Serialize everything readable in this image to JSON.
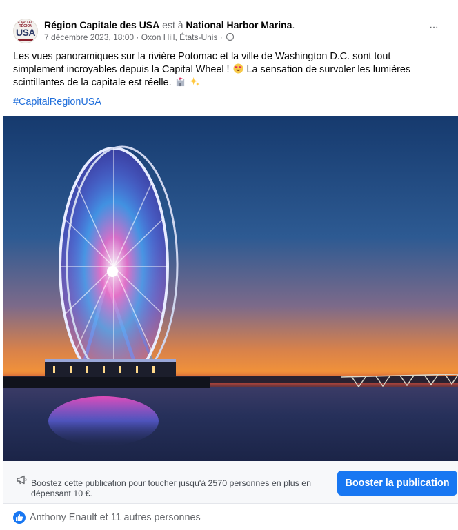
{
  "post": {
    "author": "Région Capitale des USA",
    "location_prefix": "est à",
    "location": "National Harbor Marina",
    "location_suffix": ".",
    "meta": "7 décembre 2023, 18:00 · Oxon Hill, États-Unis ·",
    "avatar": {
      "line1": "CAPITAL",
      "line2": "RÉGION",
      "line3": "USA"
    },
    "more_label": "···",
    "text_part1": "Les vues panoramiques sur la rivière Potomac et la ville de Washington D.C. sont tout simplement incroyables depuis la Capital Wheel !",
    "text_part2": "La sensation de survoler les lumières scintillantes de la capitale est réelle.",
    "hashtag": "#CapitalRegionUSA",
    "emojis": [
      "heart-eyes-emoji",
      "castle-emoji",
      "sparkles-emoji"
    ]
  },
  "boost": {
    "text": "Boostez cette publication pour toucher jusqu'à 2570 personnes en plus en dépensant 10 €.",
    "button_label": "Booster la publication"
  },
  "reactions": {
    "text": "Anthony Enault et 11 autres personnes",
    "icon": "like-icon"
  },
  "colors": {
    "accent": "#1877f2",
    "hashtag": "#216fdb",
    "muted": "#65676b"
  },
  "icons": [
    "globe-icon",
    "megaphone-icon",
    "like-icon",
    "more-options-icon"
  ]
}
